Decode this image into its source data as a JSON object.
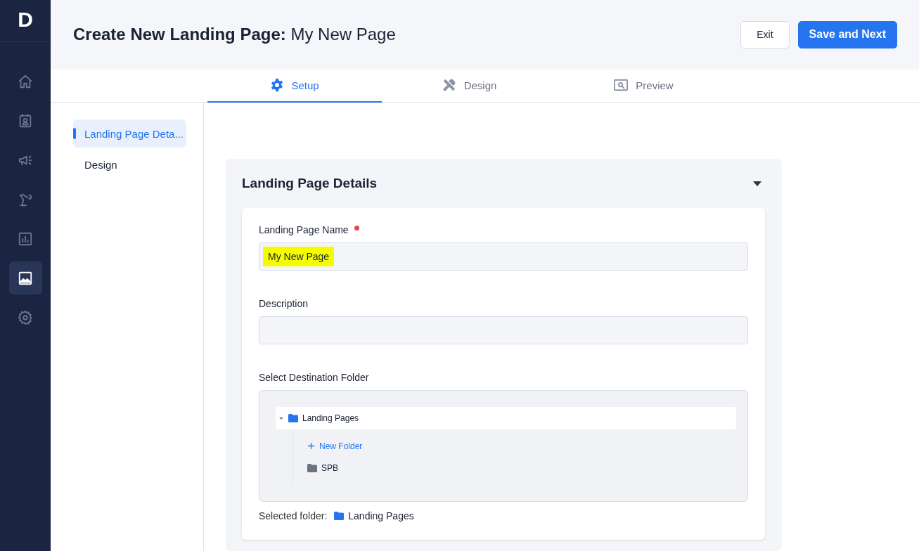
{
  "logo": "D",
  "rail": [
    {
      "kind": "home",
      "selected": false
    },
    {
      "kind": "contacts",
      "selected": false
    },
    {
      "kind": "megaphone",
      "selected": false
    },
    {
      "kind": "robot",
      "selected": false
    },
    {
      "kind": "chart",
      "selected": false
    },
    {
      "kind": "image",
      "selected": true
    },
    {
      "kind": "gear",
      "selected": false
    }
  ],
  "header": {
    "title": "Create New Landing Page:",
    "page_name": "My New Page",
    "buttons": [
      {
        "label": "Exit",
        "kind": "secondary"
      },
      {
        "label": "Save and Next",
        "kind": "primary"
      }
    ]
  },
  "tabs": [
    {
      "label": "Setup",
      "kind": "gear",
      "selected": true
    },
    {
      "label": "Design",
      "kind": "tools",
      "selected": false
    },
    {
      "label": "Preview",
      "kind": "preview",
      "selected": false
    }
  ],
  "sidebar": [
    {
      "label": "Landing Page Deta...",
      "selected": true
    },
    {
      "label": "Design",
      "selected": false
    }
  ],
  "section": {
    "title": "Landing Page Details",
    "expanded": true,
    "fields": [
      {
        "label": "Landing Page Name",
        "required": true,
        "value": "My New Page",
        "highlighted": true
      },
      {
        "label": "Description",
        "required": false
      }
    ],
    "folder_field": {
      "label": "Select Destination Folder",
      "tree": [
        {
          "name": "Landing Pages",
          "expanded": true,
          "selected": true,
          "children": [
            {
              "kind": "action",
              "name": "New Folder"
            },
            {
              "kind": "folder",
              "name": "SPB",
              "selected": false
            }
          ]
        }
      ]
    },
    "selected_folder": {
      "label": "Selected folder:",
      "value": "Landing Pages"
    }
  }
}
